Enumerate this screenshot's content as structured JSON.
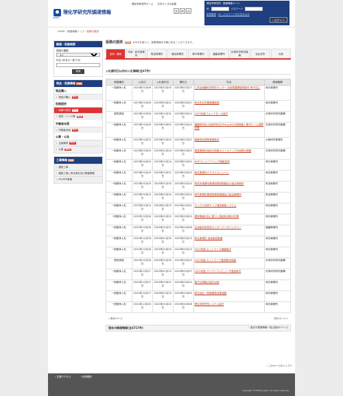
{
  "header": {
    "logo_text": "RIKEN",
    "site_title": "理化学研究所調達情報",
    "top_links": [
      "理化学研究所ホーム",
      "文字サイズの変更"
    ],
    "font_sizes": [
      "大",
      "中",
      "小"
    ],
    "login": {
      "links": [
        "理化学研究所",
        "調達情報ページ"
      ],
      "id_label": "ID",
      "password_label": "パスワード",
      "register_link": "新規登録",
      "forgot_link": "ID・パスワードをお忘れの方",
      "button": "ログイン"
    }
  },
  "breadcrumb": {
    "items": [
      "HOME",
      "調達情報トップ"
    ],
    "current": "役務の提供"
  },
  "sidebar": {
    "search": {
      "title": "調達・役務検索",
      "type_label": "調達の種類",
      "type_value": "全て",
      "keyword_label": "件名",
      "keyword_hint": "(件名の一部で可)",
      "button": "検索"
    },
    "categories": {
      "title": "物品・役務情報",
      "rss": "RSS",
      "groups": [
        {
          "label": "物品購入",
          "items": [
            {
              "label": "物品の購入",
              "new": true,
              "active": false
            }
          ]
        },
        {
          "label": "役務提供",
          "items": [
            {
              "label": "役務の提供",
              "new": true,
              "active": true
            },
            {
              "label": "賃貸・リース等",
              "new": true,
              "active": false
            }
          ]
        },
        {
          "label": "労働者派遣",
          "items": [
            {
              "label": "労働者派遣",
              "new": true,
              "active": false
            }
          ]
        },
        {
          "label": "公募・公告",
          "items": [
            {
              "label": "企画競争",
              "new": true,
              "active": false
            },
            {
              "label": "公募",
              "new": true,
              "active": false
            }
          ]
        }
      ]
    },
    "construction": {
      "title": "工事情報",
      "rss": "RSS",
      "items": [
        "建設工事",
        "建設工事に係る設計及び調査業務",
        "PFI/PPP事業"
      ]
    },
    "new_label": "New"
  },
  "main": {
    "title": "役務の提供",
    "rss": "RSS",
    "note": "※RSSを使うと、新着情報を手軽に知ることができます。",
    "tabs": [
      "全体・横浜",
      "本部・和光事業所",
      "筑波事業所",
      "横浜事業所",
      "神戸事業所",
      "播磨事業所",
      "計算科学研究機構",
      "仙台支所",
      "大阪"
    ],
    "list_title": "入札締切日以内の入札情報(全67件)",
    "columns": [
      "調達種別",
      "公告日",
      "入札締切日",
      "開札日",
      "件名",
      "調達機関"
    ],
    "rows": [
      [
        "一般競争入札",
        "2023年01月06日",
        "2023年02月03日",
        "2023年02月17日",
        "仁科加速器科学研究センター 反射鏡蓋構造物制作 硝子加工",
        "和光事業所"
      ],
      [
        "一般競争入札",
        "2023年01月06日",
        "2023年02月01日",
        "2023年02月22日",
        "和光所区防雷機器調達",
        "和光事業所"
      ],
      [
        "随意調達",
        "2023年01月06日",
        "2023年01月31日",
        "2023年02月14日",
        "2023年度フォトアタール保守",
        "計算科学研究機構"
      ],
      [
        "一般競争入札",
        "2023年01月06日",
        "2023年02月02日",
        "2023年02月14日",
        "播磨研究所(大阪府所在)SPring-8の光源検査と電子ビーム調整作業",
        "計算科学研究機構"
      ],
      [
        "一般競争入札",
        "2023年01月05日",
        "2023年01月20日",
        "2023年01月31日",
        "廃棄物処理等業務委託",
        "大阪研究事業所"
      ],
      [
        "一般競争入札",
        "2023年01月05日",
        "2023年01月24日",
        "2023年01月25日",
        "調達事務計画用の新築スケールアップ計画等の調査",
        "計算科学研究機構"
      ],
      [
        "一般競争入札",
        "2023年01月05日",
        "2023年01月24日",
        "2023年01月25日",
        "WTEエンジニアリング機能投資",
        "神戸事業所"
      ],
      [
        "一般競争入札",
        "2023年01月05日",
        "2023年01月31日",
        "2023年02月13日",
        "和光事業所クラウドストレージ",
        "和光事業所"
      ],
      [
        "一般競争入札",
        "2023年01月04日",
        "2023年01月30日",
        "2023年02月14日",
        "研究所事業所管理用電算機器及び組合事務所",
        "筑波事業所"
      ],
      [
        "一般競争入札",
        "2023年01月04日",
        "2023年01月30日",
        "2023年02月14日",
        "研究事業所管理用電算機器及び組合事務所",
        "筑波事業所"
      ],
      [
        "一般競争入札",
        "2023年01月04日",
        "2023年01月25日",
        "2023年01月31日",
        "マイクロ流体チップ運用業務システム",
        "和光事業所"
      ],
      [
        "一般競争入札",
        "2022年12月28日",
        "2023年01月25日",
        "2023年02月03日",
        "理研情報分析に基づく施設利用等の作業",
        "和光事業所"
      ],
      [
        "一般競争入札",
        "2022年12月28日",
        "2023年01月31日",
        "2023年02月08日",
        "生命医科学研究センターデータバイザリー",
        "播磨事業所"
      ],
      [
        "一般競争入札",
        "2022年12月28日",
        "2023年01月30日",
        "2023年02月15日",
        "和光事業所 地域施設整備",
        "和光事業所"
      ],
      [
        "一般競争入札",
        "2022年12月28日",
        "2023年02月03日",
        "2023年02月14日",
        "2023年度 ネットワーク機器保守",
        "和光事業所"
      ],
      [
        "随意調達",
        "2022年12月28日",
        "2023年01月30日",
        "2023年02月10日",
        "2023年度 ネットワーク監視基本検査",
        "計算科学研究機構"
      ],
      [
        "一般競争入札",
        "2022年12月27日",
        "2023年01月19日",
        "2023年02月07日",
        "2022年度 スーパーコンピュータ運用保守",
        "計算科学研究機構"
      ],
      [
        "一般競争入札",
        "2022年12月27日",
        "2023年02月01日",
        "2023年02月14日",
        "電子計算機の保守点検",
        "和光事業所"
      ],
      [
        "一般競争入札",
        "2022年12月27日",
        "2023年01月23日",
        "2023年02月09日",
        "和光地区一般廃棄物収集運搬",
        "和光事業所"
      ],
      [
        "一般競争入札",
        "2022年12月26日",
        "2023年01月20日",
        "2023年02月08日",
        "理化学研究所システム保守",
        "和光事業所"
      ]
    ],
    "pager": {
      "prev": "前のページ",
      "next": "次のページ"
    },
    "past": {
      "title": "過去の調達情報(全4717件)",
      "link": "過去の調達情報一覧(全部のページ)"
    }
  },
  "footer": {
    "to_top": "このページのトップへ",
    "links": [
      "交通アクセス",
      "利用規約"
    ],
    "copyright": "Copyright © RIKEN, Japan. All rights reserved."
  }
}
